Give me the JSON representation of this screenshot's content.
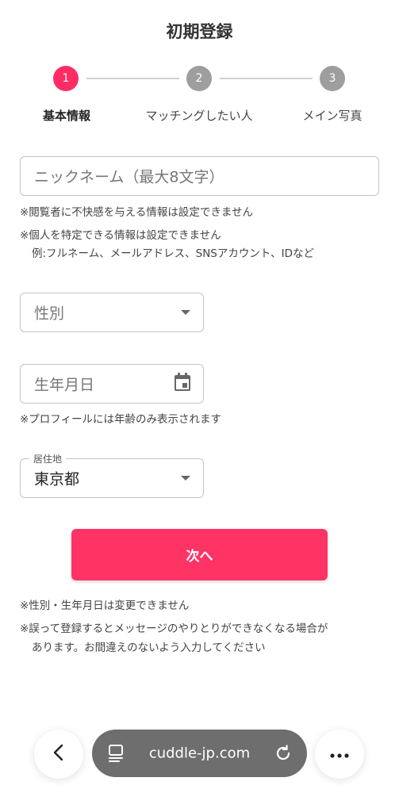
{
  "header": {
    "title": "初期登録"
  },
  "stepper": {
    "steps": [
      {
        "number": "1",
        "label": "基本情報"
      },
      {
        "number": "2",
        "label": "マッチングしたい人"
      },
      {
        "number": "3",
        "label": "メイン写真"
      }
    ]
  },
  "form": {
    "nickname": {
      "placeholder": "ニックネーム（最大8文字）",
      "notes": [
        "※閲覧者に不快感を与える情報は設定できません",
        "※個人を特定できる情報は設定できません",
        "例:フルネーム、メールアドレス、SNSアカウント、IDなど"
      ]
    },
    "gender": {
      "placeholder": "性別"
    },
    "birthdate": {
      "placeholder": "生年月日",
      "note": "※プロフィールには年齢のみ表示されます"
    },
    "residence": {
      "label": "居住地",
      "value": "東京都"
    },
    "next_label": "次へ",
    "footer_notes": [
      "※性別・生年月日は変更できません",
      "※誤って登録するとメッセージのやりとりができなくなる場合が",
      "あります。お間違えのないよう入力してください"
    ]
  },
  "browser": {
    "url": "cuddle-jp.com"
  },
  "colors": {
    "accent": "#ff2d64",
    "inactive_step": "#9e9e9e"
  },
  "icons": {
    "calendar": "calendar-icon",
    "back": "chevron-left-icon",
    "tabs": "tabs-icon",
    "reload": "reload-icon",
    "more": "more-icon"
  }
}
